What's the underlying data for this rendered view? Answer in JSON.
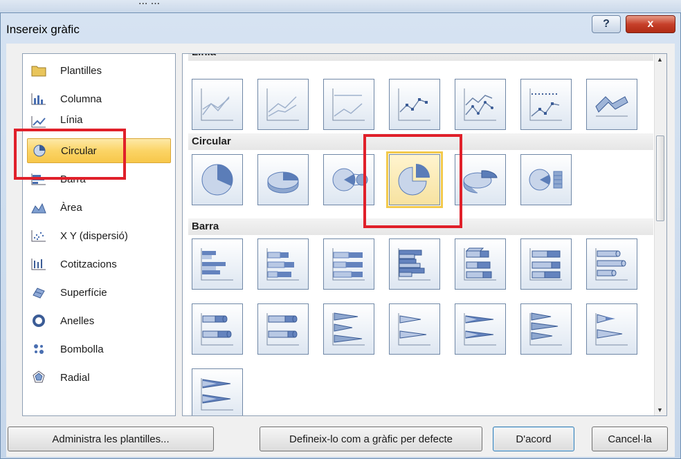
{
  "window": {
    "title": "Insereix gràfic",
    "help_glyph": "?",
    "close_glyph": "x",
    "background_fragment": "... ..."
  },
  "categories": [
    {
      "label": "Plantilles",
      "icon": "folder-icon"
    },
    {
      "label": "Columna",
      "icon": "column-chart-icon"
    },
    {
      "label": "Línia",
      "icon": "line-chart-icon"
    },
    {
      "label": "Circular",
      "icon": "pie-chart-icon",
      "selected": true
    },
    {
      "label": "Barra",
      "icon": "bar-chart-icon"
    },
    {
      "label": "Àrea",
      "icon": "area-chart-icon"
    },
    {
      "label": "X Y (dispersió)",
      "icon": "scatter-chart-icon"
    },
    {
      "label": "Cotitzacions",
      "icon": "stock-chart-icon"
    },
    {
      "label": "Superfície",
      "icon": "surface-chart-icon"
    },
    {
      "label": "Anelles",
      "icon": "doughnut-chart-icon"
    },
    {
      "label": "Bombolla",
      "icon": "bubble-chart-icon"
    },
    {
      "label": "Radial",
      "icon": "radar-chart-icon"
    }
  ],
  "gallery": {
    "sections": [
      {
        "title": "Línia",
        "tiles": 7
      },
      {
        "title": "Circular",
        "tiles": 6,
        "selected_tile": 3
      },
      {
        "title": "Barra",
        "tiles": 15
      }
    ]
  },
  "buttons": {
    "manage_templates": "Administra les plantilles...",
    "set_default": "Defineix-lo com a gràfic per defecte",
    "ok": "D'acord",
    "cancel": "Cancel·la"
  },
  "colors": {
    "accent": "#f2c94c",
    "highlight": "#e0202a",
    "chart_blue": "#5b7db8"
  }
}
